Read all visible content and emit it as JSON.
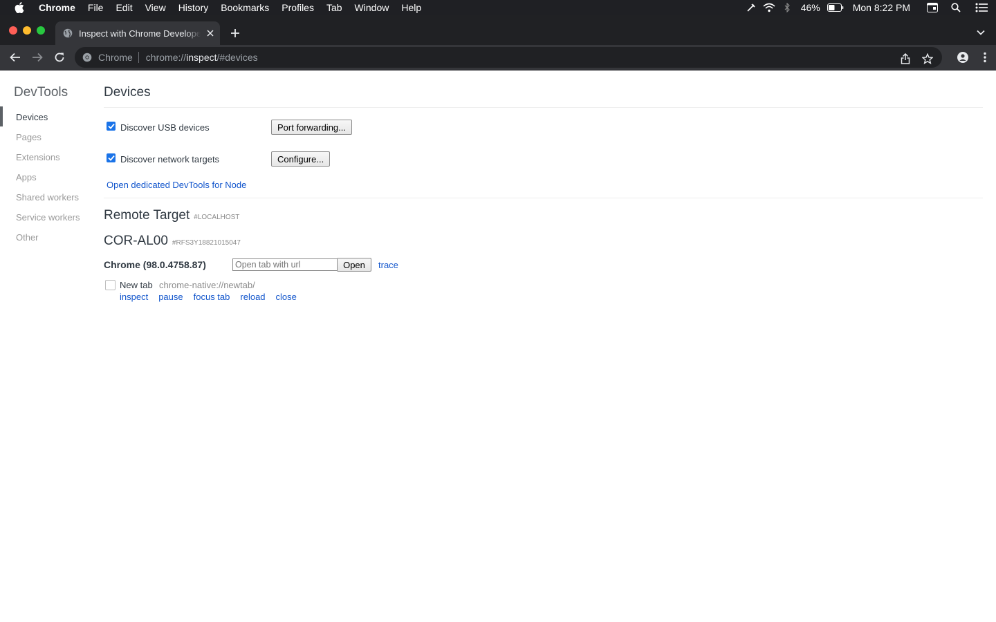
{
  "menubar": {
    "app_name": "Chrome",
    "items": [
      "File",
      "Edit",
      "View",
      "History",
      "Bookmarks",
      "Profiles",
      "Tab",
      "Window",
      "Help"
    ],
    "battery": "46%",
    "clock": "Mon 8:22 PM"
  },
  "tab": {
    "title": "Inspect with Chrome Developer Tools"
  },
  "omnibox": {
    "chip": "Chrome",
    "url_scheme": "chrome://",
    "url_host": "inspect",
    "url_rest": "/#devices"
  },
  "sidebar": {
    "title": "DevTools",
    "items": [
      "Devices",
      "Pages",
      "Extensions",
      "Apps",
      "Shared workers",
      "Service workers",
      "Other"
    ],
    "selected": "Devices"
  },
  "devices": {
    "title": "Devices",
    "discover_usb_label": "Discover USB devices",
    "discover_usb_checked": true,
    "port_forwarding_label": "Port forwarding...",
    "discover_network_label": "Discover network targets",
    "discover_network_checked": true,
    "configure_label": "Configure...",
    "node_link": "Open dedicated DevTools for Node"
  },
  "remote": {
    "title": "Remote Target",
    "tag": "#LOCALHOST",
    "device_name": "COR-AL00",
    "device_serial": "#RFS3Y18821015047",
    "browser": "Chrome (98.0.4758.87)",
    "url_placeholder": "Open tab with url",
    "open_label": "Open",
    "trace_label": "trace",
    "page": {
      "name": "New tab",
      "url": "chrome-native://newtab/",
      "actions": [
        "inspect",
        "pause",
        "focus tab",
        "reload",
        "close"
      ]
    }
  },
  "colors": {
    "link": "#1155cc",
    "checkbox": "#1a73e8",
    "chrome_dark": "#202124"
  }
}
